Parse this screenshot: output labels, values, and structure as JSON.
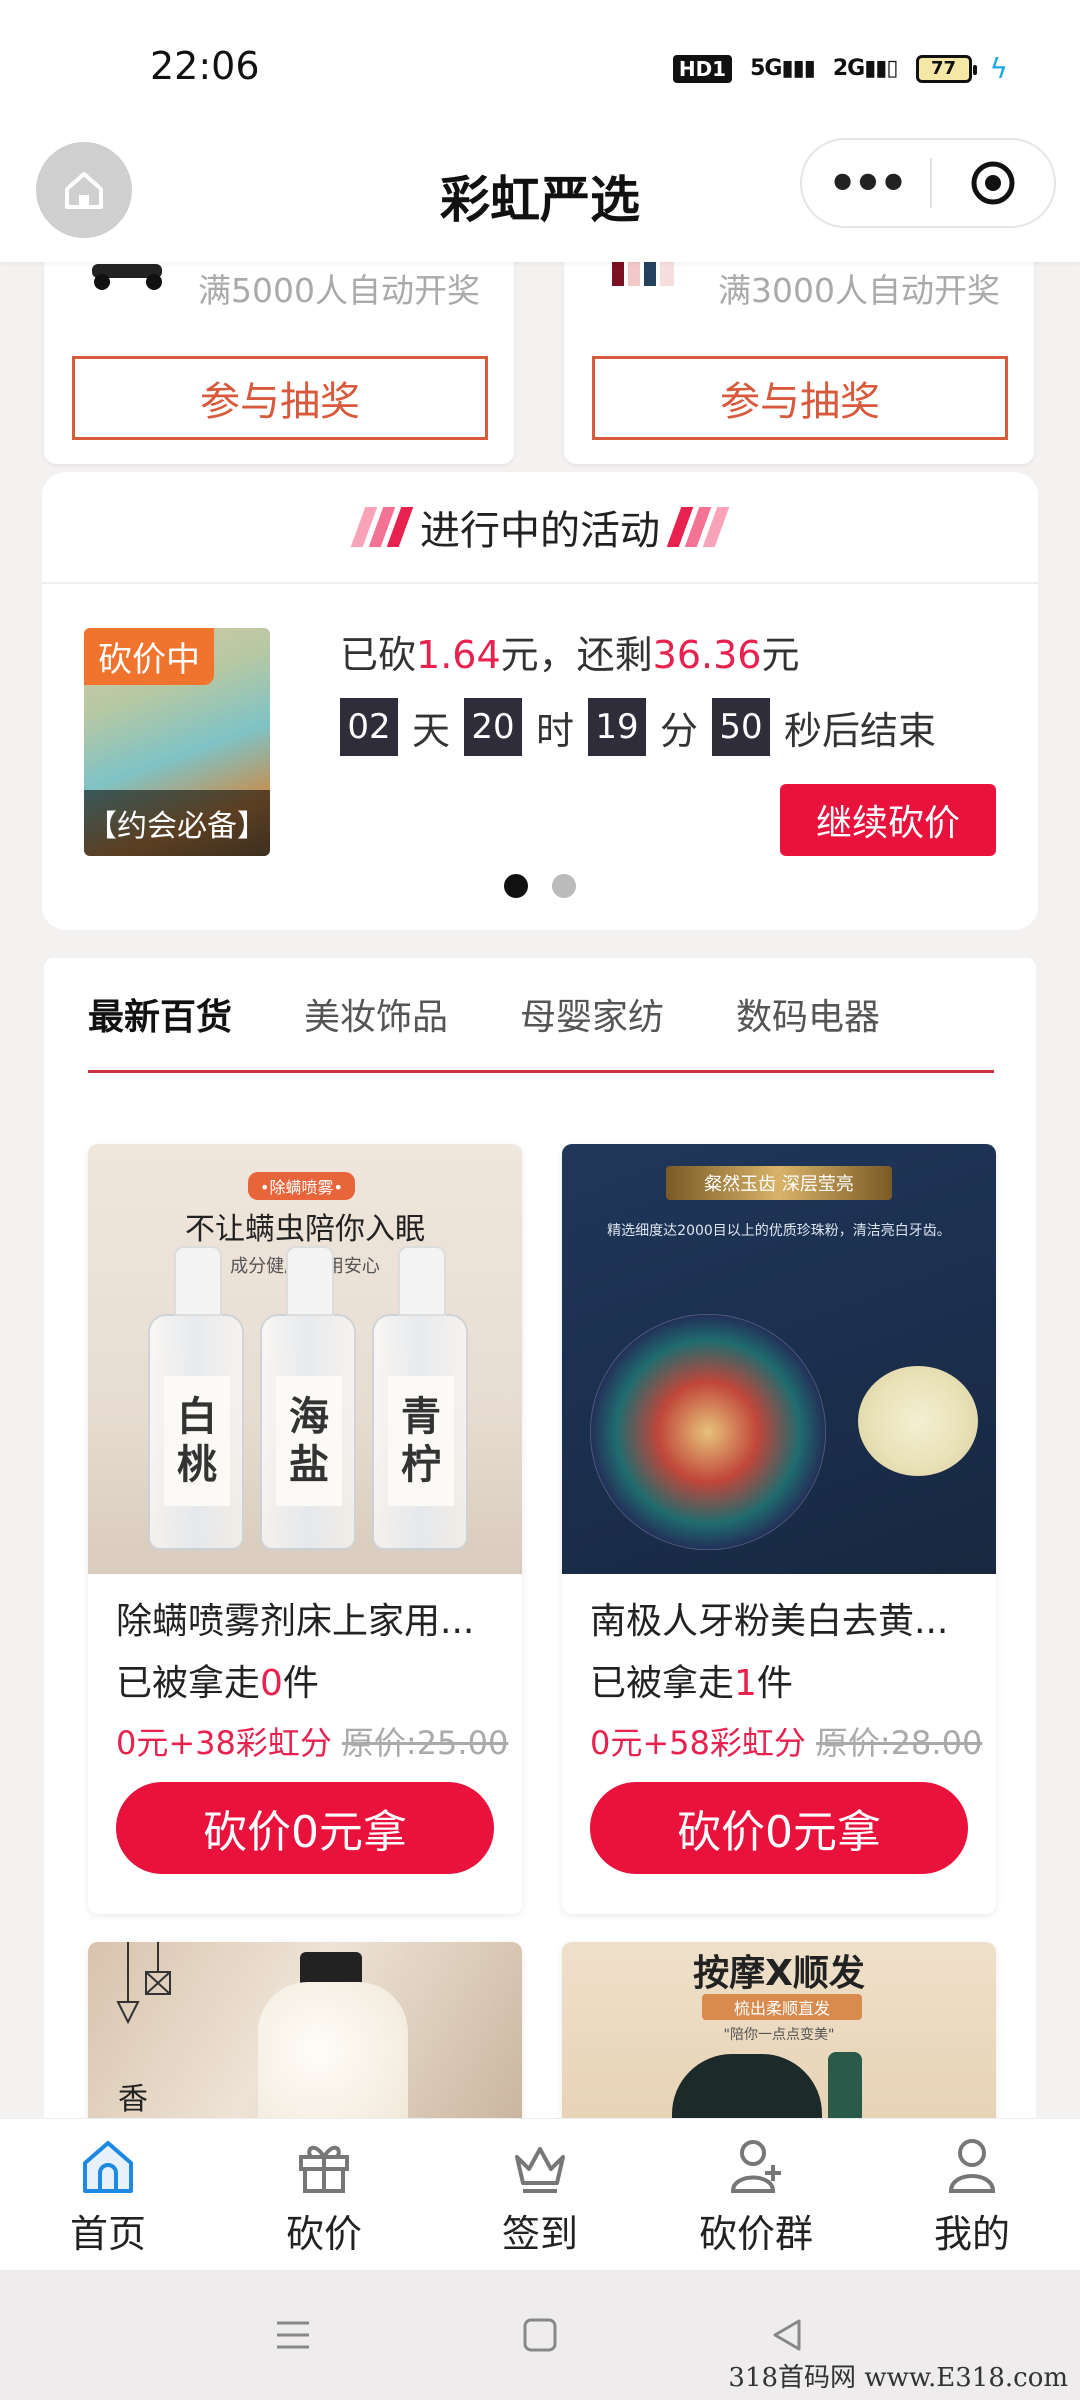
{
  "status_bar": {
    "time": "22:06",
    "hd": "HD1",
    "net1": "5G",
    "net2": "2G",
    "battery": "77"
  },
  "header": {
    "title": "彩虹严选"
  },
  "lottery": [
    {
      "note": "满5000人自动开奖",
      "button": "参与抽奖"
    },
    {
      "note": "满3000人自动开奖",
      "button": "参与抽奖"
    }
  ],
  "activity": {
    "title": "进行中的活动",
    "tag": "砍价中",
    "caption": "【约会必备】",
    "status": {
      "prefix": "已砍",
      "cut": "1.64",
      "mid": "元，还剩",
      "remain": "36.36",
      "suffix": "元"
    },
    "countdown": {
      "days": "02",
      "days_label": "天",
      "hours": "20",
      "hours_label": "时",
      "minutes": "19",
      "minutes_label": "分",
      "seconds": "50",
      "seconds_label": "秒后结束"
    },
    "button": "继续砍价"
  },
  "tabs": [
    "最新百货",
    "美妆饰品",
    "母婴家纺",
    "数码电器"
  ],
  "products": [
    {
      "title": "除螨喷雾剂床上家用...",
      "taken_prefix": "已被拿走",
      "taken_count": "0",
      "taken_suffix": "件",
      "price": "0元+38彩虹分",
      "orig_price": "原价:25.00",
      "button": "砍价0元拿",
      "img": {
        "badge": "•除螨喷雾•",
        "headline": "不让螨虫陪你入眠",
        "sub": "成分健康  使用安心",
        "labels": [
          "白桃",
          "海盐",
          "青柠"
        ]
      }
    },
    {
      "title": "南极人牙粉美白去黄...",
      "taken_prefix": "已被拿走",
      "taken_count": "1",
      "taken_suffix": "件",
      "price": "0元+58彩虹分",
      "orig_price": "原价:28.00",
      "button": "砍价0元拿",
      "img": {
        "banner": "粲然玉齿 深层莹亮",
        "desc": "精选细度达2000目以上的优质珍珠粉，清洁亮白牙齿。"
      }
    },
    {
      "img": {
        "text": "香"
      }
    },
    {
      "img": {
        "t1": "按摩X顺发",
        "t2": "梳出柔顺直发",
        "t3": "\"陪你一点点变美\""
      }
    }
  ],
  "tabbar": [
    {
      "label": "首页",
      "icon": "home-icon",
      "active": true
    },
    {
      "label": "砍价",
      "icon": "gift-icon"
    },
    {
      "label": "签到",
      "icon": "crown-icon"
    },
    {
      "label": "砍价群",
      "icon": "add-user-icon"
    },
    {
      "label": "我的",
      "icon": "user-icon"
    }
  ],
  "watermark": "318首码网 www.E318.com",
  "colors": {
    "accent_red": "#e8123c",
    "lottery_orange": "#d8593b",
    "tab_active_blue": "#1e88e5",
    "tag_orange": "#f0732e"
  }
}
